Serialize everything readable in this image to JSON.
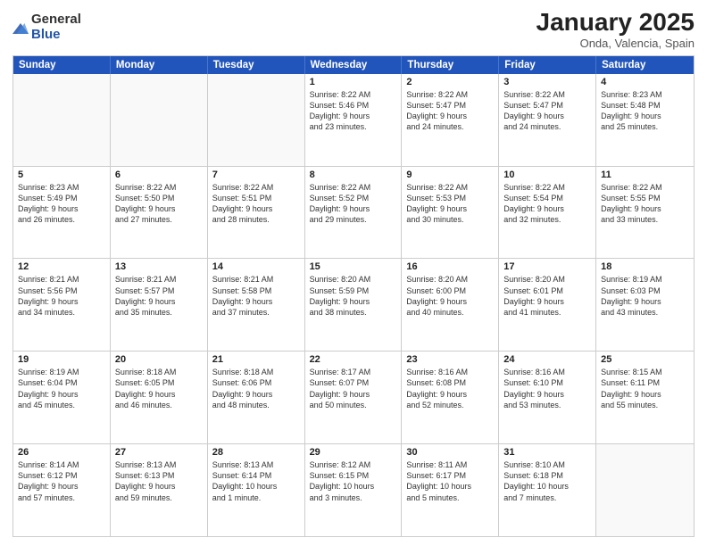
{
  "logo": {
    "general": "General",
    "blue": "Blue"
  },
  "header": {
    "month": "January 2025",
    "location": "Onda, Valencia, Spain"
  },
  "weekdays": [
    "Sunday",
    "Monday",
    "Tuesday",
    "Wednesday",
    "Thursday",
    "Friday",
    "Saturday"
  ],
  "weeks": [
    [
      {
        "day": "",
        "info": ""
      },
      {
        "day": "",
        "info": ""
      },
      {
        "day": "",
        "info": ""
      },
      {
        "day": "1",
        "info": "Sunrise: 8:22 AM\nSunset: 5:46 PM\nDaylight: 9 hours\nand 23 minutes."
      },
      {
        "day": "2",
        "info": "Sunrise: 8:22 AM\nSunset: 5:47 PM\nDaylight: 9 hours\nand 24 minutes."
      },
      {
        "day": "3",
        "info": "Sunrise: 8:22 AM\nSunset: 5:47 PM\nDaylight: 9 hours\nand 24 minutes."
      },
      {
        "day": "4",
        "info": "Sunrise: 8:23 AM\nSunset: 5:48 PM\nDaylight: 9 hours\nand 25 minutes."
      }
    ],
    [
      {
        "day": "5",
        "info": "Sunrise: 8:23 AM\nSunset: 5:49 PM\nDaylight: 9 hours\nand 26 minutes."
      },
      {
        "day": "6",
        "info": "Sunrise: 8:22 AM\nSunset: 5:50 PM\nDaylight: 9 hours\nand 27 minutes."
      },
      {
        "day": "7",
        "info": "Sunrise: 8:22 AM\nSunset: 5:51 PM\nDaylight: 9 hours\nand 28 minutes."
      },
      {
        "day": "8",
        "info": "Sunrise: 8:22 AM\nSunset: 5:52 PM\nDaylight: 9 hours\nand 29 minutes."
      },
      {
        "day": "9",
        "info": "Sunrise: 8:22 AM\nSunset: 5:53 PM\nDaylight: 9 hours\nand 30 minutes."
      },
      {
        "day": "10",
        "info": "Sunrise: 8:22 AM\nSunset: 5:54 PM\nDaylight: 9 hours\nand 32 minutes."
      },
      {
        "day": "11",
        "info": "Sunrise: 8:22 AM\nSunset: 5:55 PM\nDaylight: 9 hours\nand 33 minutes."
      }
    ],
    [
      {
        "day": "12",
        "info": "Sunrise: 8:21 AM\nSunset: 5:56 PM\nDaylight: 9 hours\nand 34 minutes."
      },
      {
        "day": "13",
        "info": "Sunrise: 8:21 AM\nSunset: 5:57 PM\nDaylight: 9 hours\nand 35 minutes."
      },
      {
        "day": "14",
        "info": "Sunrise: 8:21 AM\nSunset: 5:58 PM\nDaylight: 9 hours\nand 37 minutes."
      },
      {
        "day": "15",
        "info": "Sunrise: 8:20 AM\nSunset: 5:59 PM\nDaylight: 9 hours\nand 38 minutes."
      },
      {
        "day": "16",
        "info": "Sunrise: 8:20 AM\nSunset: 6:00 PM\nDaylight: 9 hours\nand 40 minutes."
      },
      {
        "day": "17",
        "info": "Sunrise: 8:20 AM\nSunset: 6:01 PM\nDaylight: 9 hours\nand 41 minutes."
      },
      {
        "day": "18",
        "info": "Sunrise: 8:19 AM\nSunset: 6:03 PM\nDaylight: 9 hours\nand 43 minutes."
      }
    ],
    [
      {
        "day": "19",
        "info": "Sunrise: 8:19 AM\nSunset: 6:04 PM\nDaylight: 9 hours\nand 45 minutes."
      },
      {
        "day": "20",
        "info": "Sunrise: 8:18 AM\nSunset: 6:05 PM\nDaylight: 9 hours\nand 46 minutes."
      },
      {
        "day": "21",
        "info": "Sunrise: 8:18 AM\nSunset: 6:06 PM\nDaylight: 9 hours\nand 48 minutes."
      },
      {
        "day": "22",
        "info": "Sunrise: 8:17 AM\nSunset: 6:07 PM\nDaylight: 9 hours\nand 50 minutes."
      },
      {
        "day": "23",
        "info": "Sunrise: 8:16 AM\nSunset: 6:08 PM\nDaylight: 9 hours\nand 52 minutes."
      },
      {
        "day": "24",
        "info": "Sunrise: 8:16 AM\nSunset: 6:10 PM\nDaylight: 9 hours\nand 53 minutes."
      },
      {
        "day": "25",
        "info": "Sunrise: 8:15 AM\nSunset: 6:11 PM\nDaylight: 9 hours\nand 55 minutes."
      }
    ],
    [
      {
        "day": "26",
        "info": "Sunrise: 8:14 AM\nSunset: 6:12 PM\nDaylight: 9 hours\nand 57 minutes."
      },
      {
        "day": "27",
        "info": "Sunrise: 8:13 AM\nSunset: 6:13 PM\nDaylight: 9 hours\nand 59 minutes."
      },
      {
        "day": "28",
        "info": "Sunrise: 8:13 AM\nSunset: 6:14 PM\nDaylight: 10 hours\nand 1 minute."
      },
      {
        "day": "29",
        "info": "Sunrise: 8:12 AM\nSunset: 6:15 PM\nDaylight: 10 hours\nand 3 minutes."
      },
      {
        "day": "30",
        "info": "Sunrise: 8:11 AM\nSunset: 6:17 PM\nDaylight: 10 hours\nand 5 minutes."
      },
      {
        "day": "31",
        "info": "Sunrise: 8:10 AM\nSunset: 6:18 PM\nDaylight: 10 hours\nand 7 minutes."
      },
      {
        "day": "",
        "info": ""
      }
    ]
  ]
}
